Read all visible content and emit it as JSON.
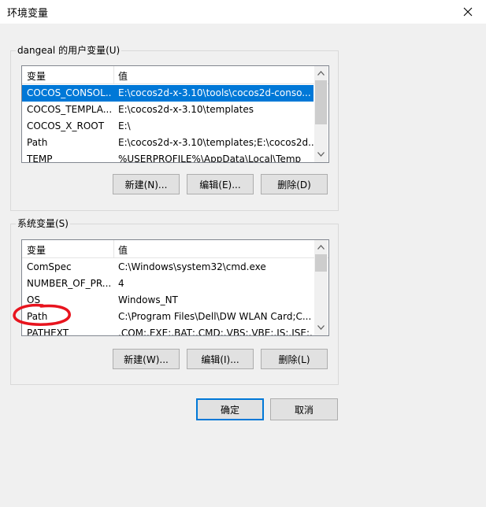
{
  "window": {
    "title": "环境变量"
  },
  "user_vars": {
    "legend": "dangeal 的用户变量(U)",
    "col_name": "变量",
    "col_value": "值",
    "rows": [
      {
        "name": "COCOS_CONSOL...",
        "value": "E:\\cocos2d-x-3.10\\tools\\cocos2d-conso..."
      },
      {
        "name": "COCOS_TEMPLA...",
        "value": "E:\\cocos2d-x-3.10\\templates"
      },
      {
        "name": "COCOS_X_ROOT",
        "value": "E:\\"
      },
      {
        "name": "Path",
        "value": "E:\\cocos2d-x-3.10\\templates;E:\\cocos2d..."
      },
      {
        "name": "TEMP",
        "value": "%USERPROFILE%\\AppData\\Local\\Temp"
      }
    ],
    "buttons": {
      "new": "新建(N)...",
      "edit": "编辑(E)...",
      "delete": "删除(D)"
    }
  },
  "system_vars": {
    "legend": "系统变量(S)",
    "col_name": "变量",
    "col_value": "值",
    "rows": [
      {
        "name": "ComSpec",
        "value": "C:\\Windows\\system32\\cmd.exe"
      },
      {
        "name": "NUMBER_OF_PR...",
        "value": "4"
      },
      {
        "name": "OS",
        "value": "Windows_NT"
      },
      {
        "name": "Path",
        "value": "C:\\Program Files\\Dell\\DW WLAN Card;C..."
      },
      {
        "name": "PATHEXT",
        "value": ".COM;.EXE;.BAT;.CMD;.VBS;.VBE;.JS;.JSE;..."
      }
    ],
    "buttons": {
      "new": "新建(W)...",
      "edit": "编辑(I)...",
      "delete": "删除(L)"
    }
  },
  "footer": {
    "ok": "确定",
    "cancel": "取消"
  },
  "colors": {
    "selection": "#0078d7",
    "annotation": "#e8141e"
  },
  "annotation": {
    "shape": "red-ellipse",
    "target": "system_vars.rows.3"
  }
}
